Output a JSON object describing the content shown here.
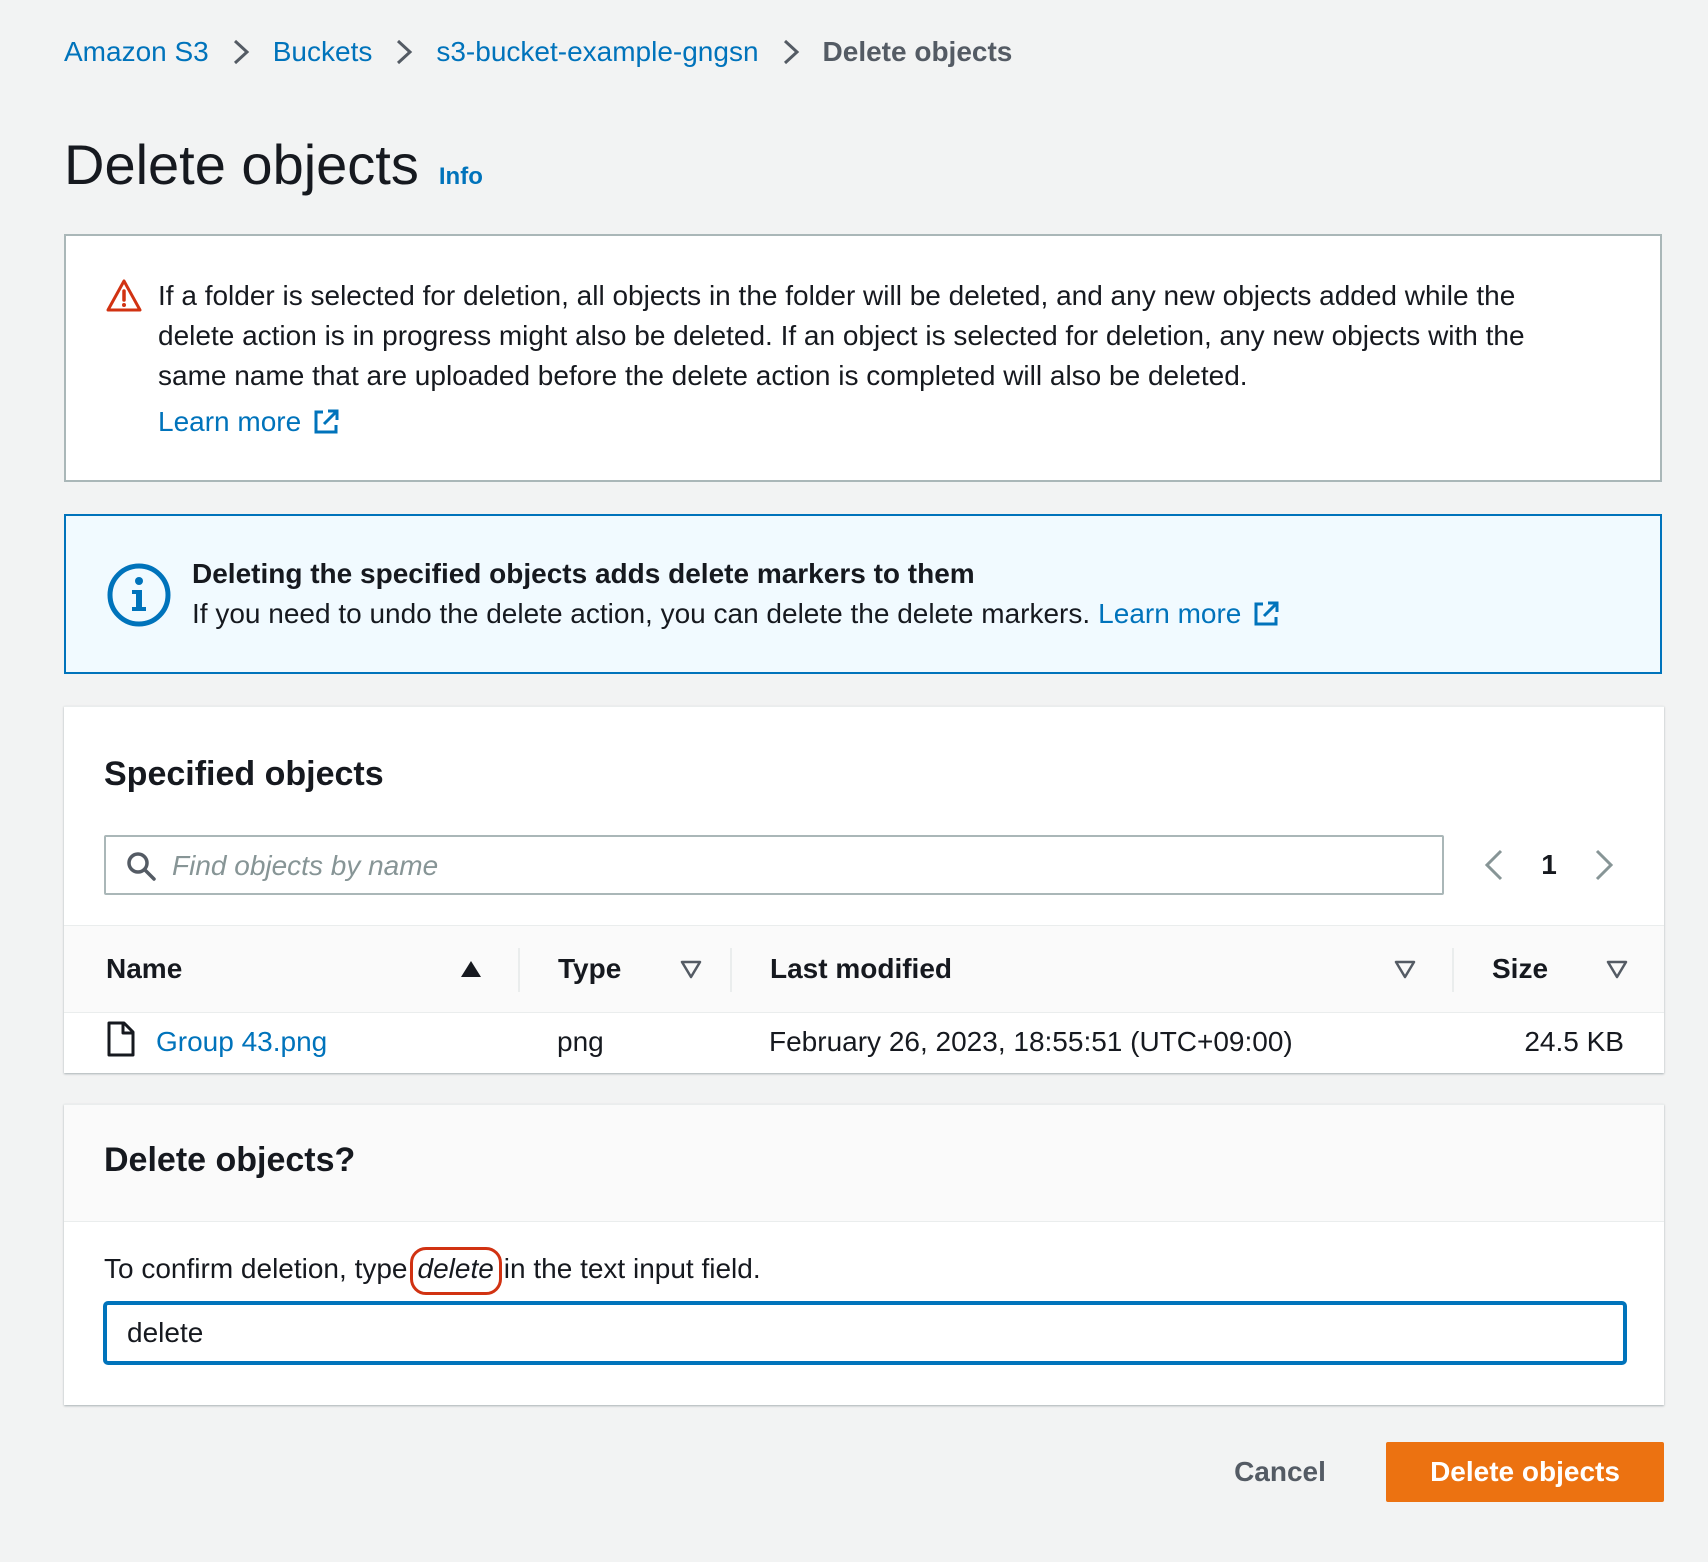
{
  "breadcrumb": {
    "items": [
      "Amazon S3",
      "Buckets",
      "s3-bucket-example-gngsn"
    ],
    "current": "Delete objects"
  },
  "header": {
    "title": "Delete objects",
    "info_link": "Info"
  },
  "warning": {
    "icon": "warning-triangle-icon",
    "text": "If a folder is selected for deletion, all objects in the folder will be deleted, and any new objects added while the delete action is in progress might also be deleted. If an object is selected for deletion, any new objects with the same name that are uploaded before the delete action is completed will also be deleted.",
    "learn_more": "Learn more"
  },
  "info": {
    "icon": "info-circle-icon",
    "heading": "Deleting the specified objects adds delete markers to them",
    "body": "If you need to undo the delete action, you can delete the delete markers.",
    "learn_more": "Learn more"
  },
  "objects": {
    "title": "Specified objects",
    "search_placeholder": "Find objects by name",
    "page": "1",
    "columns": {
      "name": "Name",
      "type": "Type",
      "last_modified": "Last modified",
      "size": "Size"
    },
    "rows": [
      {
        "name": "Group 43.png",
        "type": "png",
        "last_modified": "February 26, 2023, 18:55:51 (UTC+09:00)",
        "size": "24.5 KB"
      }
    ]
  },
  "confirm": {
    "title": "Delete objects?",
    "label_before": "To confirm deletion, type",
    "keyword": "delete",
    "label_after": "in the text input field.",
    "input_value": "delete"
  },
  "actions": {
    "cancel": "Cancel",
    "delete": "Delete objects"
  },
  "colors": {
    "link": "#0073bb",
    "primary_button": "#ec7211",
    "warning_icon": "#d13212",
    "highlight_ring": "#d13212",
    "info_background": "#f1faff"
  }
}
